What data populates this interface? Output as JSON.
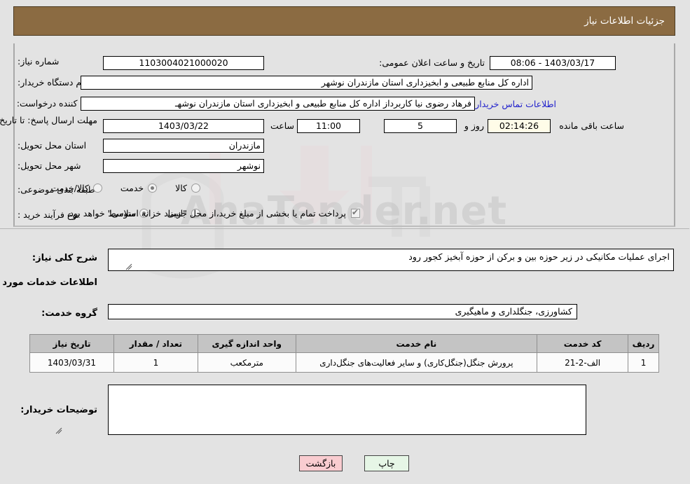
{
  "header": {
    "title": "جزئیات اطلاعات نیاز"
  },
  "watermark": {
    "text": "AnaTender.net"
  },
  "form": {
    "need_number": {
      "label": "شماره نیاز:",
      "value": "1103004021000020"
    },
    "announce_date": {
      "label": "تاریخ و ساعت اعلان عمومی:",
      "value": "1403/03/17 - 08:06"
    },
    "buyer_org": {
      "label": "نام دستگاه خریدار:",
      "value": "اداره کل منابع طبیعی و ابخیزداری استان مازندران  نوشهر"
    },
    "creator": {
      "label": "ایجاد کننده درخواست:",
      "value": "فرهاد رضوی نیا کاربرداز اداره کل منابع طبیعی و ابخیزداری استان مازندران  نوشهـ"
    },
    "buyer_contact_link": "اطلاعات تماس خریدار",
    "deadline": {
      "label": "مهلت ارسال پاسخ: تا تاریخ:",
      "date": "1403/03/22",
      "time_label": "ساعت",
      "time": "11:00",
      "days": "5",
      "days_label": "روز و",
      "countdown": "02:14:26",
      "remaining_label": "ساعت باقی مانده"
    },
    "province": {
      "label": "استان محل تحویل:",
      "value": "مازندران"
    },
    "city": {
      "label": "شهر محل تحویل:",
      "value": "نوشهر"
    },
    "category": {
      "label": "طبقه بندی موضوعی:",
      "options": [
        "کالا",
        "خدمت",
        "کالا/خدمت"
      ],
      "selected": "خدمت"
    },
    "purchase_type": {
      "label": "نوع فرآیند خرید :",
      "options": [
        "جزیی",
        "متوسط"
      ],
      "selected": "متوسط"
    },
    "treasury_note": "پرداخت تمام یا بخشی از مبلغ خرید،از محل \"اسناد خزانه اسلامی\" خواهد بود."
  },
  "description": {
    "label": "شرح کلی نیاز:",
    "value": "اجرای عملیات مکانیکی در زیر حوزه بین و برکن از حوزه آبخیز کجور رود"
  },
  "services_section": {
    "heading": "اطلاعات خدمات مورد نیاز",
    "group_label": "گروه خدمت:",
    "group_value": "کشاورزی، جنگلداری و ماهیگیری"
  },
  "table": {
    "headers": [
      "ردیف",
      "کد خدمت",
      "نام خدمت",
      "واحد اندازه گیری",
      "تعداد / مقدار",
      "تاریخ نیاز"
    ],
    "rows": [
      {
        "row": "1",
        "code": "الف-2-21",
        "name": "پرورش جنگل(جنگل‌کاری) و سایر فعالیت‌های جنگل‌داری",
        "unit": "مترمکعب",
        "qty": "1",
        "date": "1403/03/31"
      }
    ]
  },
  "buyer_notes": {
    "label": "توضیحات خریدار:",
    "value": ""
  },
  "buttons": {
    "back": "بازگشت",
    "print": "چاپ"
  },
  "colors": {
    "header_bg": "#8b6b42",
    "page_bg": "#e3e3e3",
    "link": "#2222cc",
    "back_btn": "#f9ccd0",
    "print_btn": "#e6f6e6",
    "table_header": "#c4c4c4"
  }
}
